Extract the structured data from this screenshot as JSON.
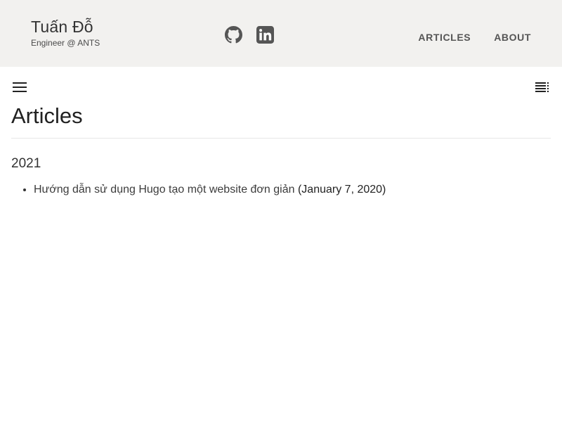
{
  "header": {
    "site_title": "Tuấn Đỗ",
    "site_subtitle": "Engineer @ ANTS",
    "social": [
      {
        "icon": "github-icon"
      },
      {
        "icon": "linkedin-icon"
      }
    ],
    "nav": [
      {
        "label": "ARTICLES"
      },
      {
        "label": "ABOUT"
      }
    ]
  },
  "toolbar": {
    "menu_icon": "hamburger-menu-icon",
    "toc_icon": "table-of-contents-icon"
  },
  "main": {
    "page_title": "Articles",
    "groups": [
      {
        "year": "2021",
        "articles": [
          {
            "title": "Hướng dẫn sử dụng Hugo tạo một website đơn giản",
            "date": "(January 7, 2020)"
          }
        ]
      }
    ]
  },
  "colors": {
    "header_background": "#f2f1ef",
    "icon_color": "#555555",
    "text_color": "#212121"
  }
}
